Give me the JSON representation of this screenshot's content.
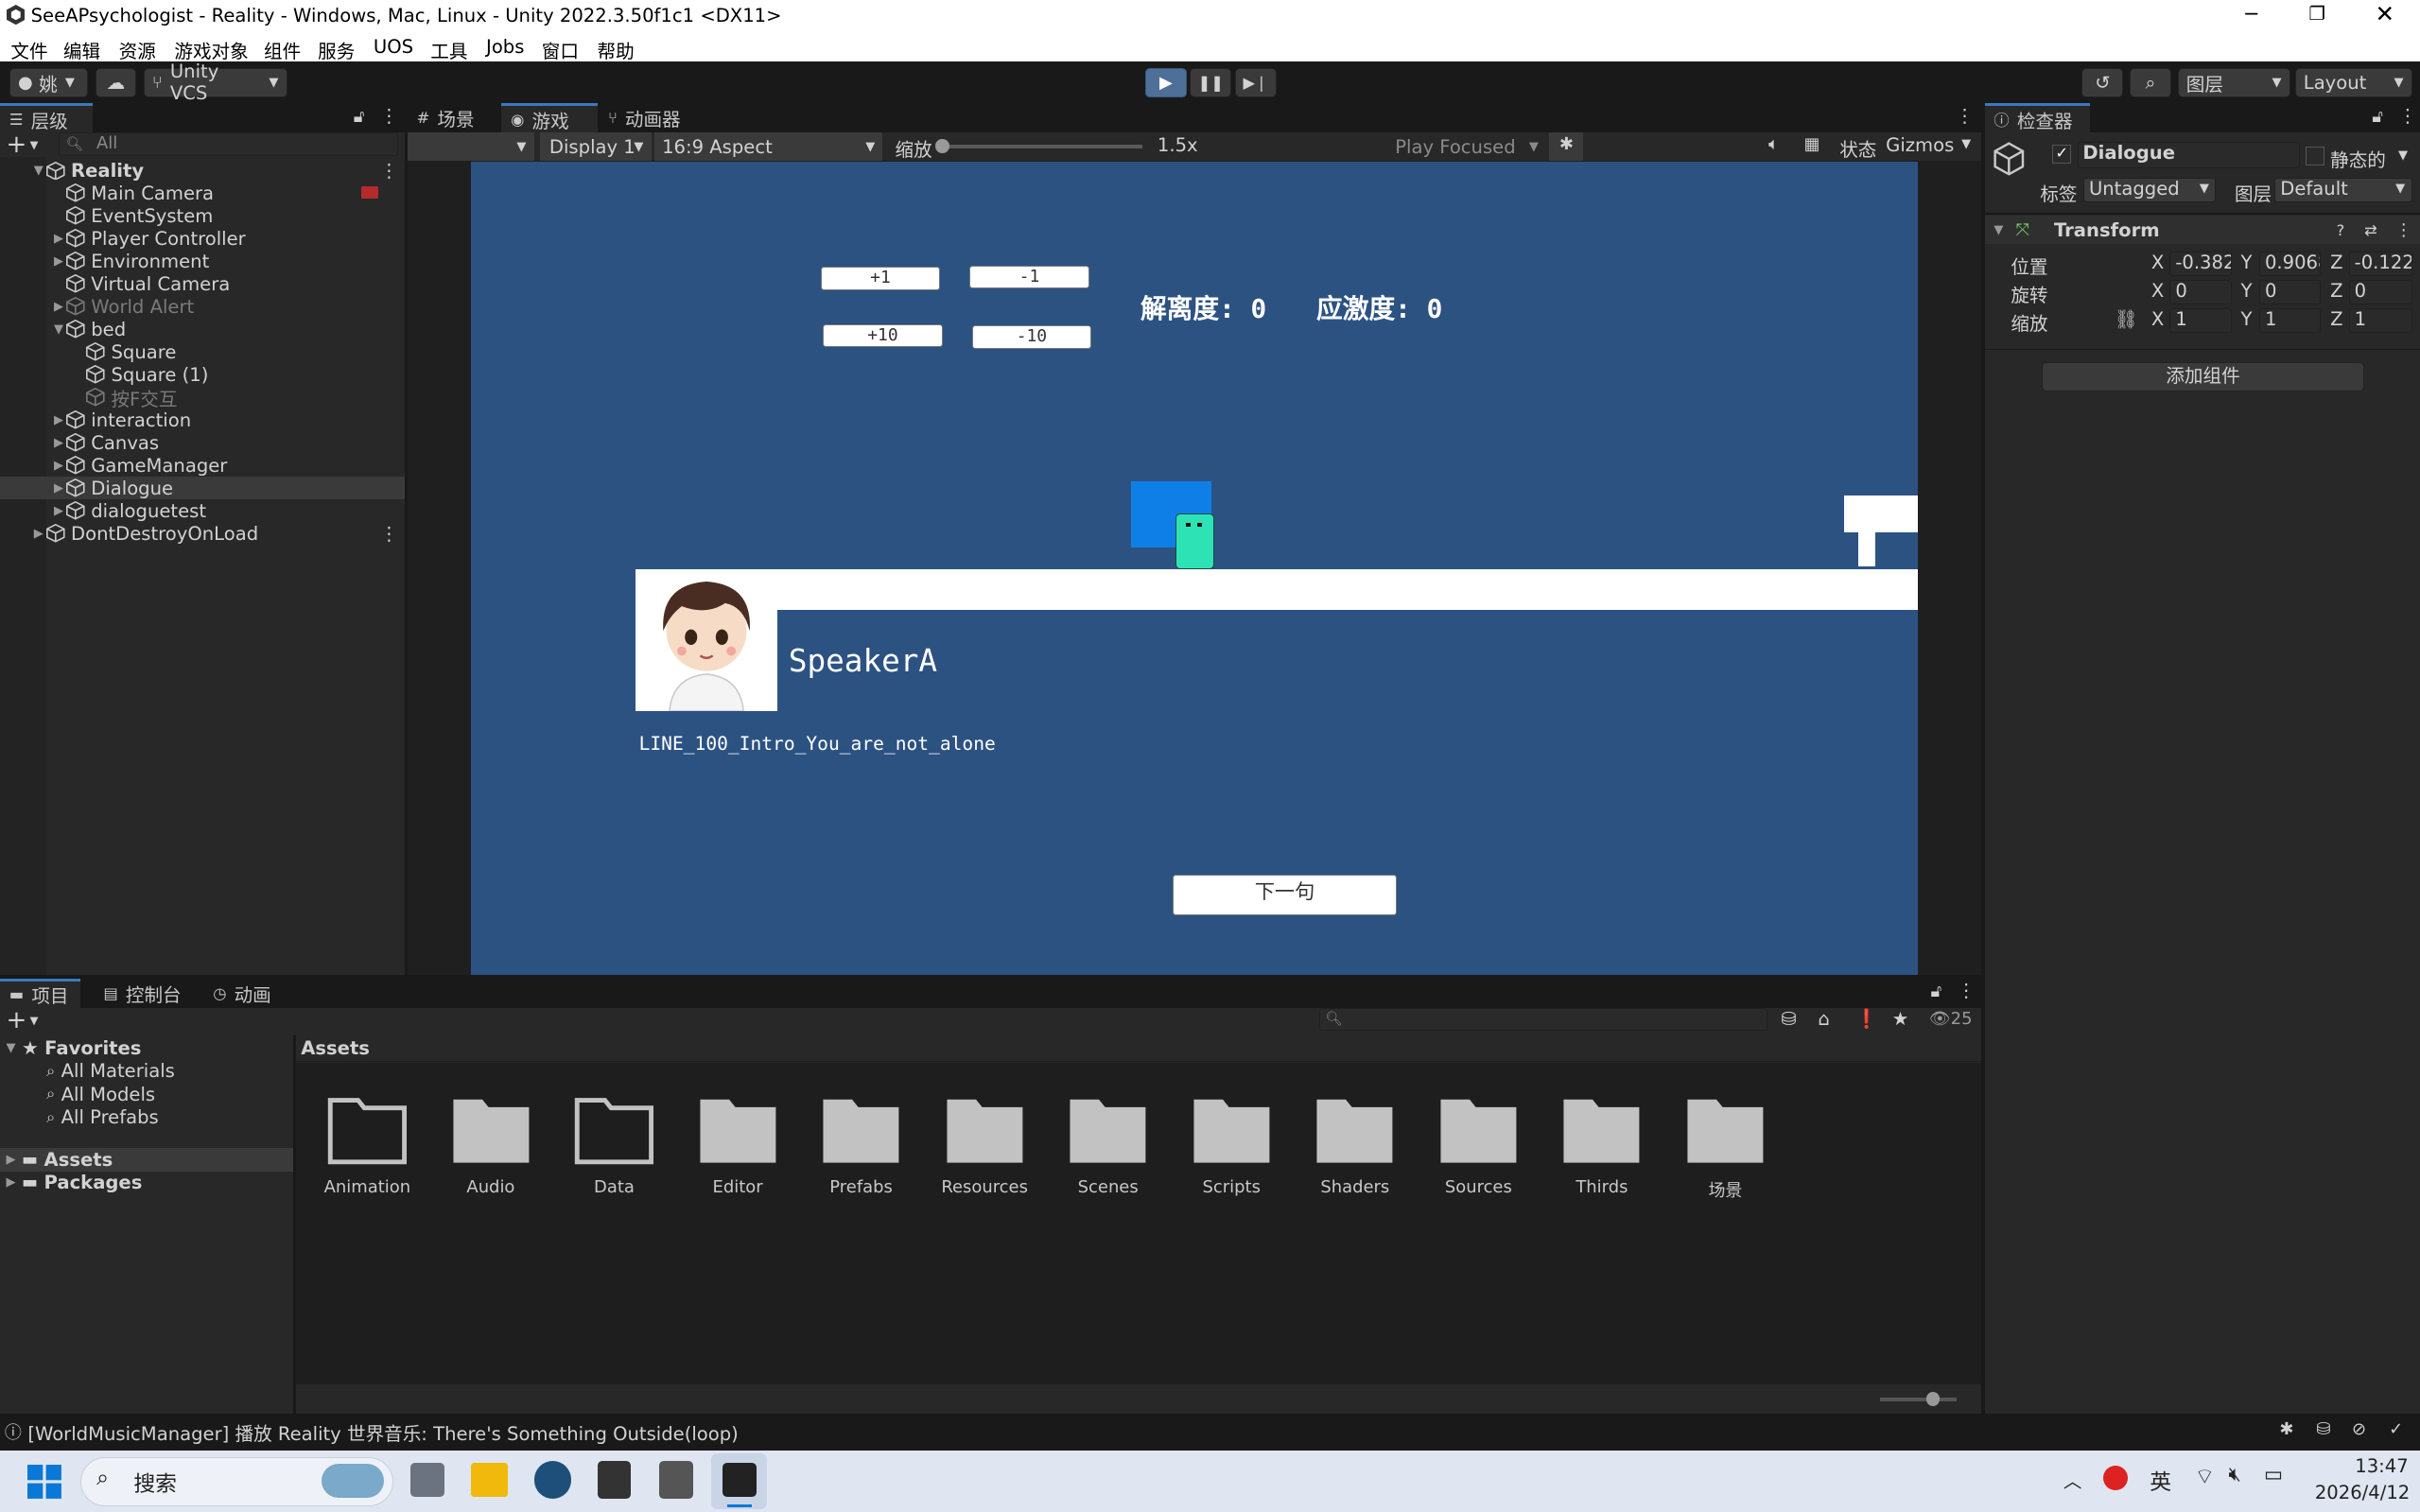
{
  "window": {
    "title": "SeeAPsychologist - Reality - Windows, Mac, Linux - Unity 2022.3.50f1c1 <DX11>"
  },
  "menu": [
    "文件",
    "编辑",
    "资源",
    "游戏对象",
    "组件",
    "服务",
    "UOS",
    "工具",
    "Jobs",
    "窗口",
    "帮助"
  ],
  "toolbar": {
    "account": "姚",
    "vcs": "Unity VCS",
    "layers": "图层",
    "layout": "Layout"
  },
  "hierarchy": {
    "tab": "层级",
    "search_placeholder": "All",
    "items": [
      {
        "label": "Reality",
        "depth": 0,
        "arrow": "▼",
        "bold": true
      },
      {
        "label": "Main Camera",
        "depth": 1
      },
      {
        "label": "EventSystem",
        "depth": 1
      },
      {
        "label": "Player Controller",
        "depth": 1,
        "arrow": "▶"
      },
      {
        "label": "Environment",
        "depth": 1,
        "arrow": "▶"
      },
      {
        "label": "Virtual Camera",
        "depth": 1
      },
      {
        "label": "World Alert",
        "depth": 1,
        "arrow": "▶",
        "dim": true
      },
      {
        "label": "bed",
        "depth": 1,
        "arrow": "▼"
      },
      {
        "label": "Square",
        "depth": 2
      },
      {
        "label": "Square (1)",
        "depth": 2
      },
      {
        "label": "按F交互",
        "depth": 2,
        "dim": true
      },
      {
        "label": "interaction",
        "depth": 1,
        "arrow": "▶"
      },
      {
        "label": "Canvas",
        "depth": 1,
        "arrow": "▶"
      },
      {
        "label": "GameManager",
        "depth": 1,
        "arrow": "▶"
      },
      {
        "label": "Dialogue",
        "depth": 1,
        "arrow": "▶",
        "selected": true
      },
      {
        "label": "dialoguetest",
        "depth": 1,
        "arrow": "▶"
      },
      {
        "label": "DontDestroyOnLoad",
        "depth": 0,
        "arrow": "▶"
      }
    ]
  },
  "center_tabs": [
    "场景",
    "游戏",
    "动画器"
  ],
  "game_toolbar": {
    "display": "Display 1",
    "aspect": "16:9 Aspect",
    "scale_label": "缩放",
    "scale_value": "1.5x",
    "play_mode": "Play Focused",
    "stats": "状态",
    "gizmos": "Gizmos"
  },
  "game": {
    "buttons": [
      "+1",
      "-1",
      "+10",
      "-10"
    ],
    "stat1": "解离度: 0",
    "stat2": "应激度: 0",
    "speaker": "SpeakerA",
    "line": "LINE_100_Intro_You_are_not_alone",
    "next_button": "下一句",
    "colors": {
      "bg": "#2c5282",
      "blue_block": "#0f7fe8",
      "player": "#2de3b6"
    }
  },
  "inspector": {
    "tab": "检查器",
    "object_name": "Dialogue",
    "static_label": "静态的",
    "tag_label": "标签",
    "tag_value": "Untagged",
    "layer_label": "图层",
    "layer_value": "Default",
    "component": "Transform",
    "rows": [
      {
        "label": "位置",
        "x": "-0.382",
        "y": "0.9068",
        "z": "-0.122"
      },
      {
        "label": "旋转",
        "x": "0",
        "y": "0",
        "z": "0"
      },
      {
        "label": "缩放",
        "x": "1",
        "y": "1",
        "z": "1"
      }
    ],
    "add_component": "添加组件"
  },
  "bottom_tabs": [
    "项目",
    "控制台",
    "动画"
  ],
  "project": {
    "favorites": "Favorites",
    "fav_items": [
      "All Materials",
      "All Models",
      "All Prefabs"
    ],
    "roots": [
      "Assets",
      "Packages"
    ],
    "breadcrumb": "Assets",
    "hidden_count": "25",
    "folders": [
      "Animation",
      "Audio",
      "Data",
      "Editor",
      "Prefabs",
      "Resources",
      "Scenes",
      "Scripts",
      "Shaders",
      "Sources",
      "Thirds",
      "场景"
    ]
  },
  "status_bar": "[WorldMusicManager] 播放 Reality 世界音乐: There's Something Outside(loop)",
  "taskbar": {
    "search": "搜索",
    "ime": "英",
    "time": "13:47",
    "date": "2026/4/12"
  }
}
